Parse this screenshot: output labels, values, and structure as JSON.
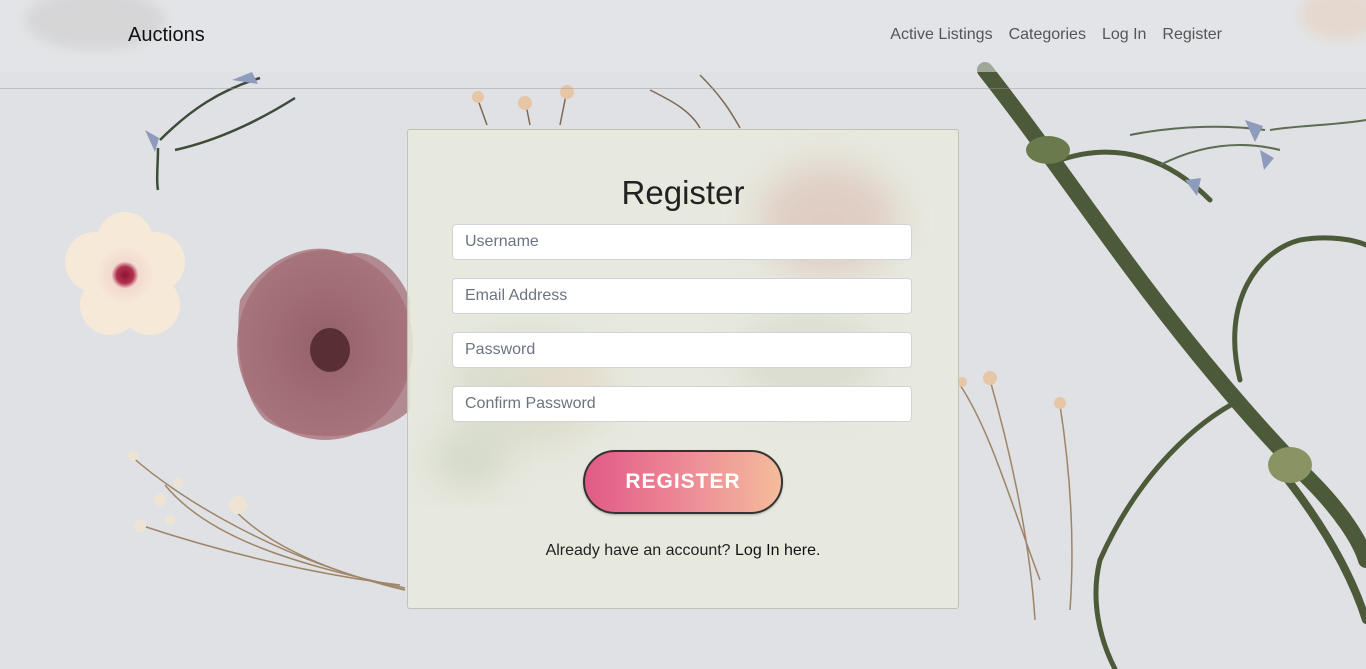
{
  "navbar": {
    "brand": "Auctions",
    "links": [
      {
        "label": "Active Listings"
      },
      {
        "label": "Categories"
      },
      {
        "label": "Log In"
      },
      {
        "label": "Register"
      }
    ]
  },
  "form": {
    "title": "Register",
    "fields": [
      {
        "placeholder": "Username",
        "value": ""
      },
      {
        "placeholder": "Email Address",
        "value": ""
      },
      {
        "placeholder": "Password",
        "value": ""
      },
      {
        "placeholder": "Confirm Password",
        "value": ""
      }
    ],
    "submit_label": "REGISTER",
    "footer_prompt": "Already have an account?",
    "login_link": "Log In here."
  },
  "colors": {
    "button_gradient_start": "#e15a86",
    "button_gradient_end": "#f4bc9b",
    "card_background": "#e8eade",
    "page_background": "#dfe1e4"
  }
}
